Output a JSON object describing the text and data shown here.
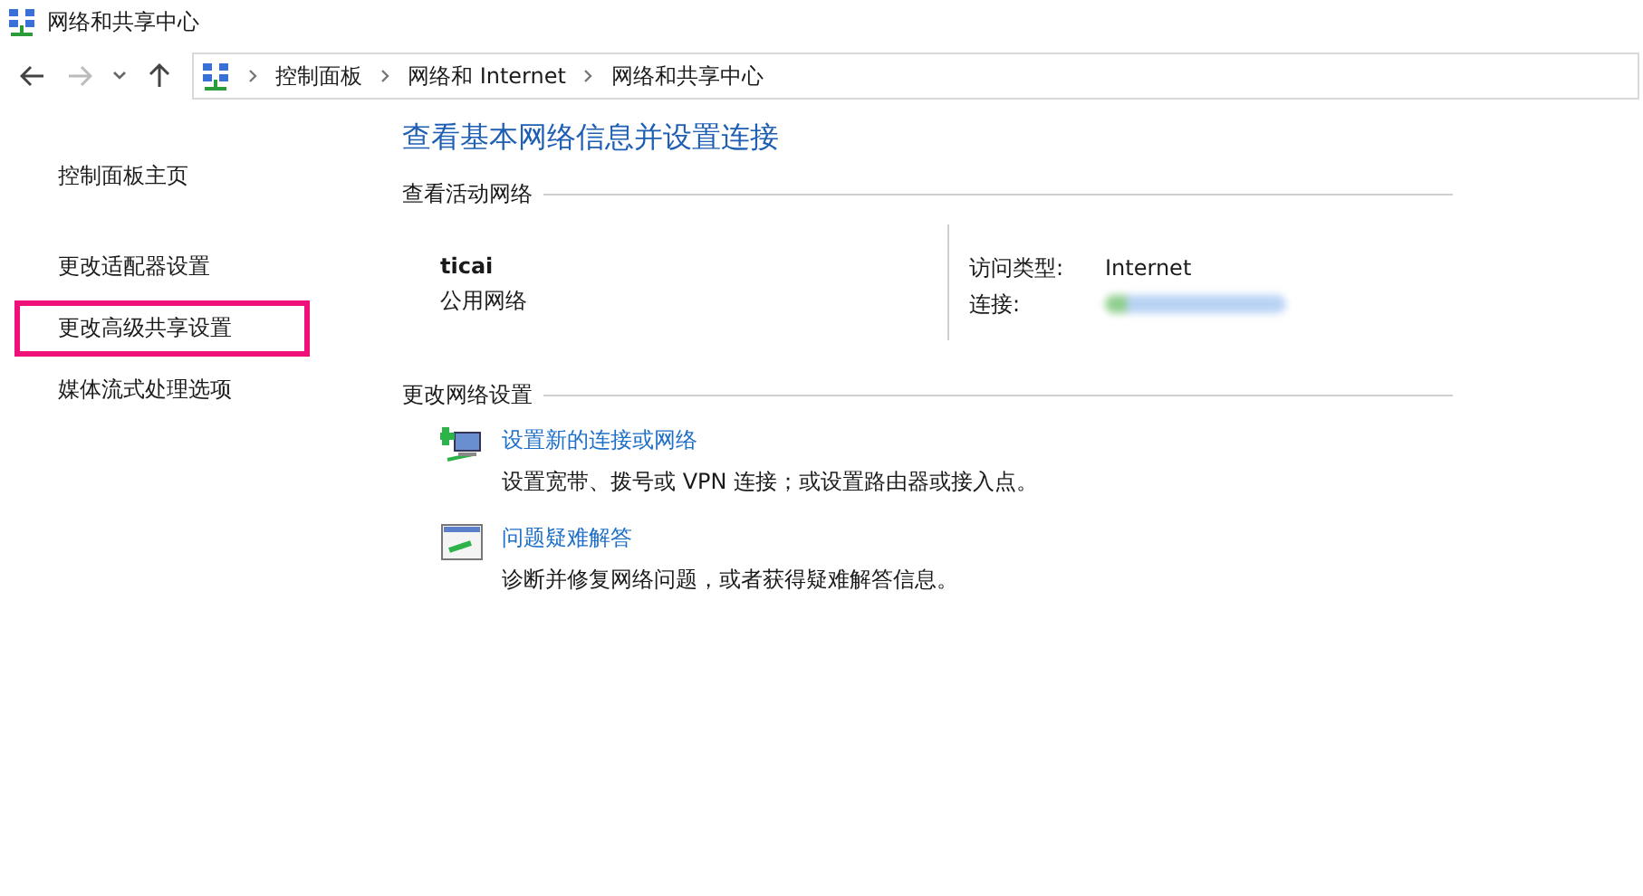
{
  "window": {
    "title": "网络和共享中心"
  },
  "address_bar": {
    "breadcrumbs": [
      "控制面板",
      "网络和 Internet",
      "网络和共享中心"
    ]
  },
  "sidebar": {
    "items": [
      {
        "label": "控制面板主页",
        "highlighted": false
      },
      {
        "label": "更改适配器设置",
        "highlighted": false
      },
      {
        "label": "更改高级共享设置",
        "highlighted": true
      },
      {
        "label": "媒体流式处理选项",
        "highlighted": false
      }
    ]
  },
  "main": {
    "heading": "查看基本网络信息并设置连接",
    "active_networks": {
      "title": "查看活动网络",
      "name": "ticai",
      "category": "公用网络",
      "details": [
        {
          "label": "访问类型:",
          "value": "Internet",
          "kind": "text"
        },
        {
          "label": "连接:",
          "kind": "blurred"
        }
      ]
    },
    "change_settings": {
      "title": "更改网络设置",
      "tasks": [
        {
          "kind": "new-connection",
          "link": "设置新的连接或网络",
          "description": "设置宽带、拨号或 VPN 连接；或设置路由器或接入点。"
        },
        {
          "kind": "troubleshoot",
          "link": "问题疑难解答",
          "description": "诊断并修复网络问题，或者获得疑难解答信息。"
        }
      ]
    }
  }
}
